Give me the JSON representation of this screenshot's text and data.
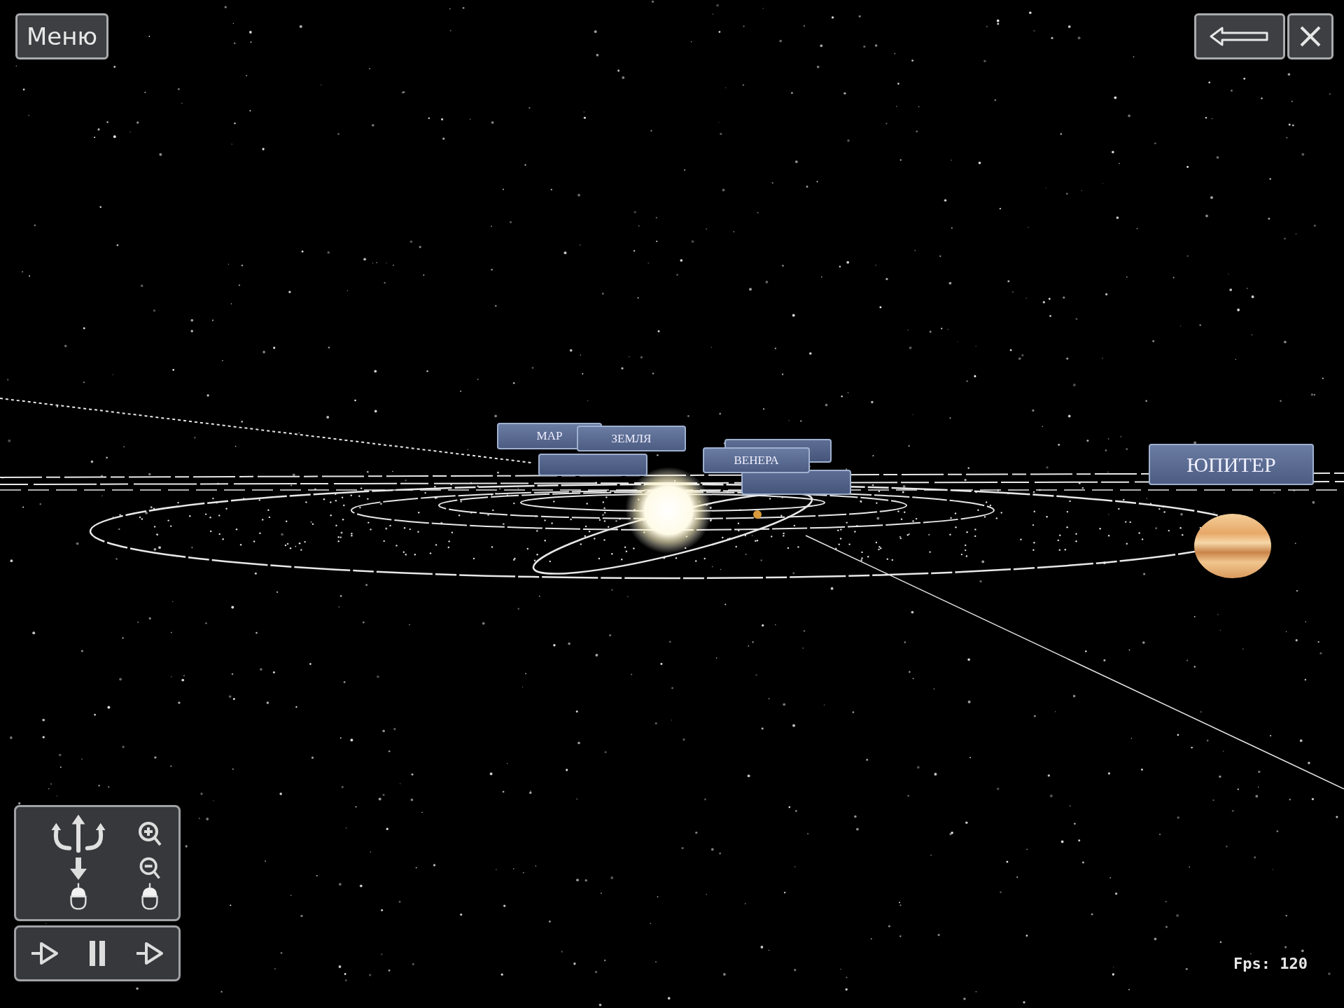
{
  "menu_button": {
    "label": "Меню"
  },
  "planet_labels": [
    {
      "text": "МАР"
    },
    {
      "text": "ЗЕМЛЯ"
    },
    {
      "text": "ВЕНЕРА"
    },
    {
      "text": "ЮПИТЕР"
    }
  ],
  "fps_counter": "Fps: 120"
}
